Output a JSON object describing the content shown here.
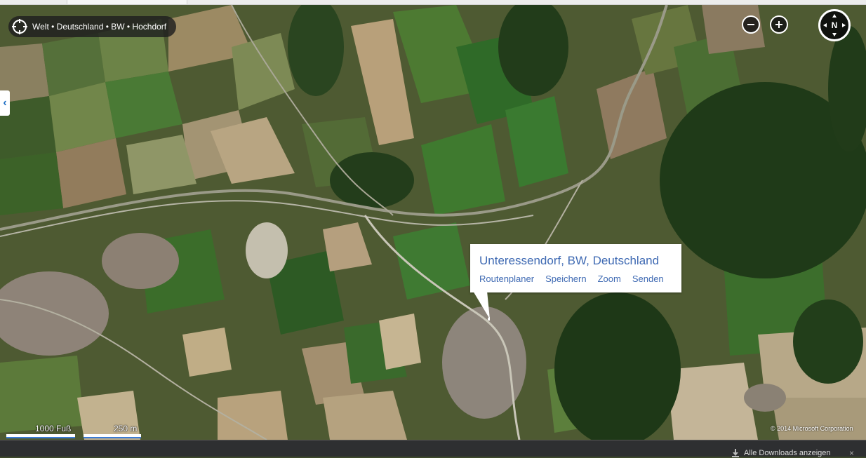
{
  "breadcrumb": {
    "text": "Welt • Deutschland • BW • Hochdorf",
    "icon": "locate-target-icon"
  },
  "controls": {
    "zoom_out": "−",
    "zoom_in": "+",
    "compass_label": "N"
  },
  "sidebar_toggle": {
    "glyph": "‹",
    "icon": "chevron-left-icon"
  },
  "popup": {
    "title": "Unteressendorf, BW, Deutschland",
    "actions": [
      "Routenplaner",
      "Speichern",
      "Zoom",
      "Senden"
    ]
  },
  "scale": {
    "imperial": "1000 Fuß",
    "metric": "250 m"
  },
  "copyright": "© 2014 Microsoft Corporation",
  "download_bar": {
    "label": "Alle Downloads anzeigen",
    "close": "×"
  },
  "colors": {
    "link_blue": "#3f6ab3",
    "scale_blue": "#3a7bd5",
    "breadcrumb_bg": "#1e1e1e"
  }
}
